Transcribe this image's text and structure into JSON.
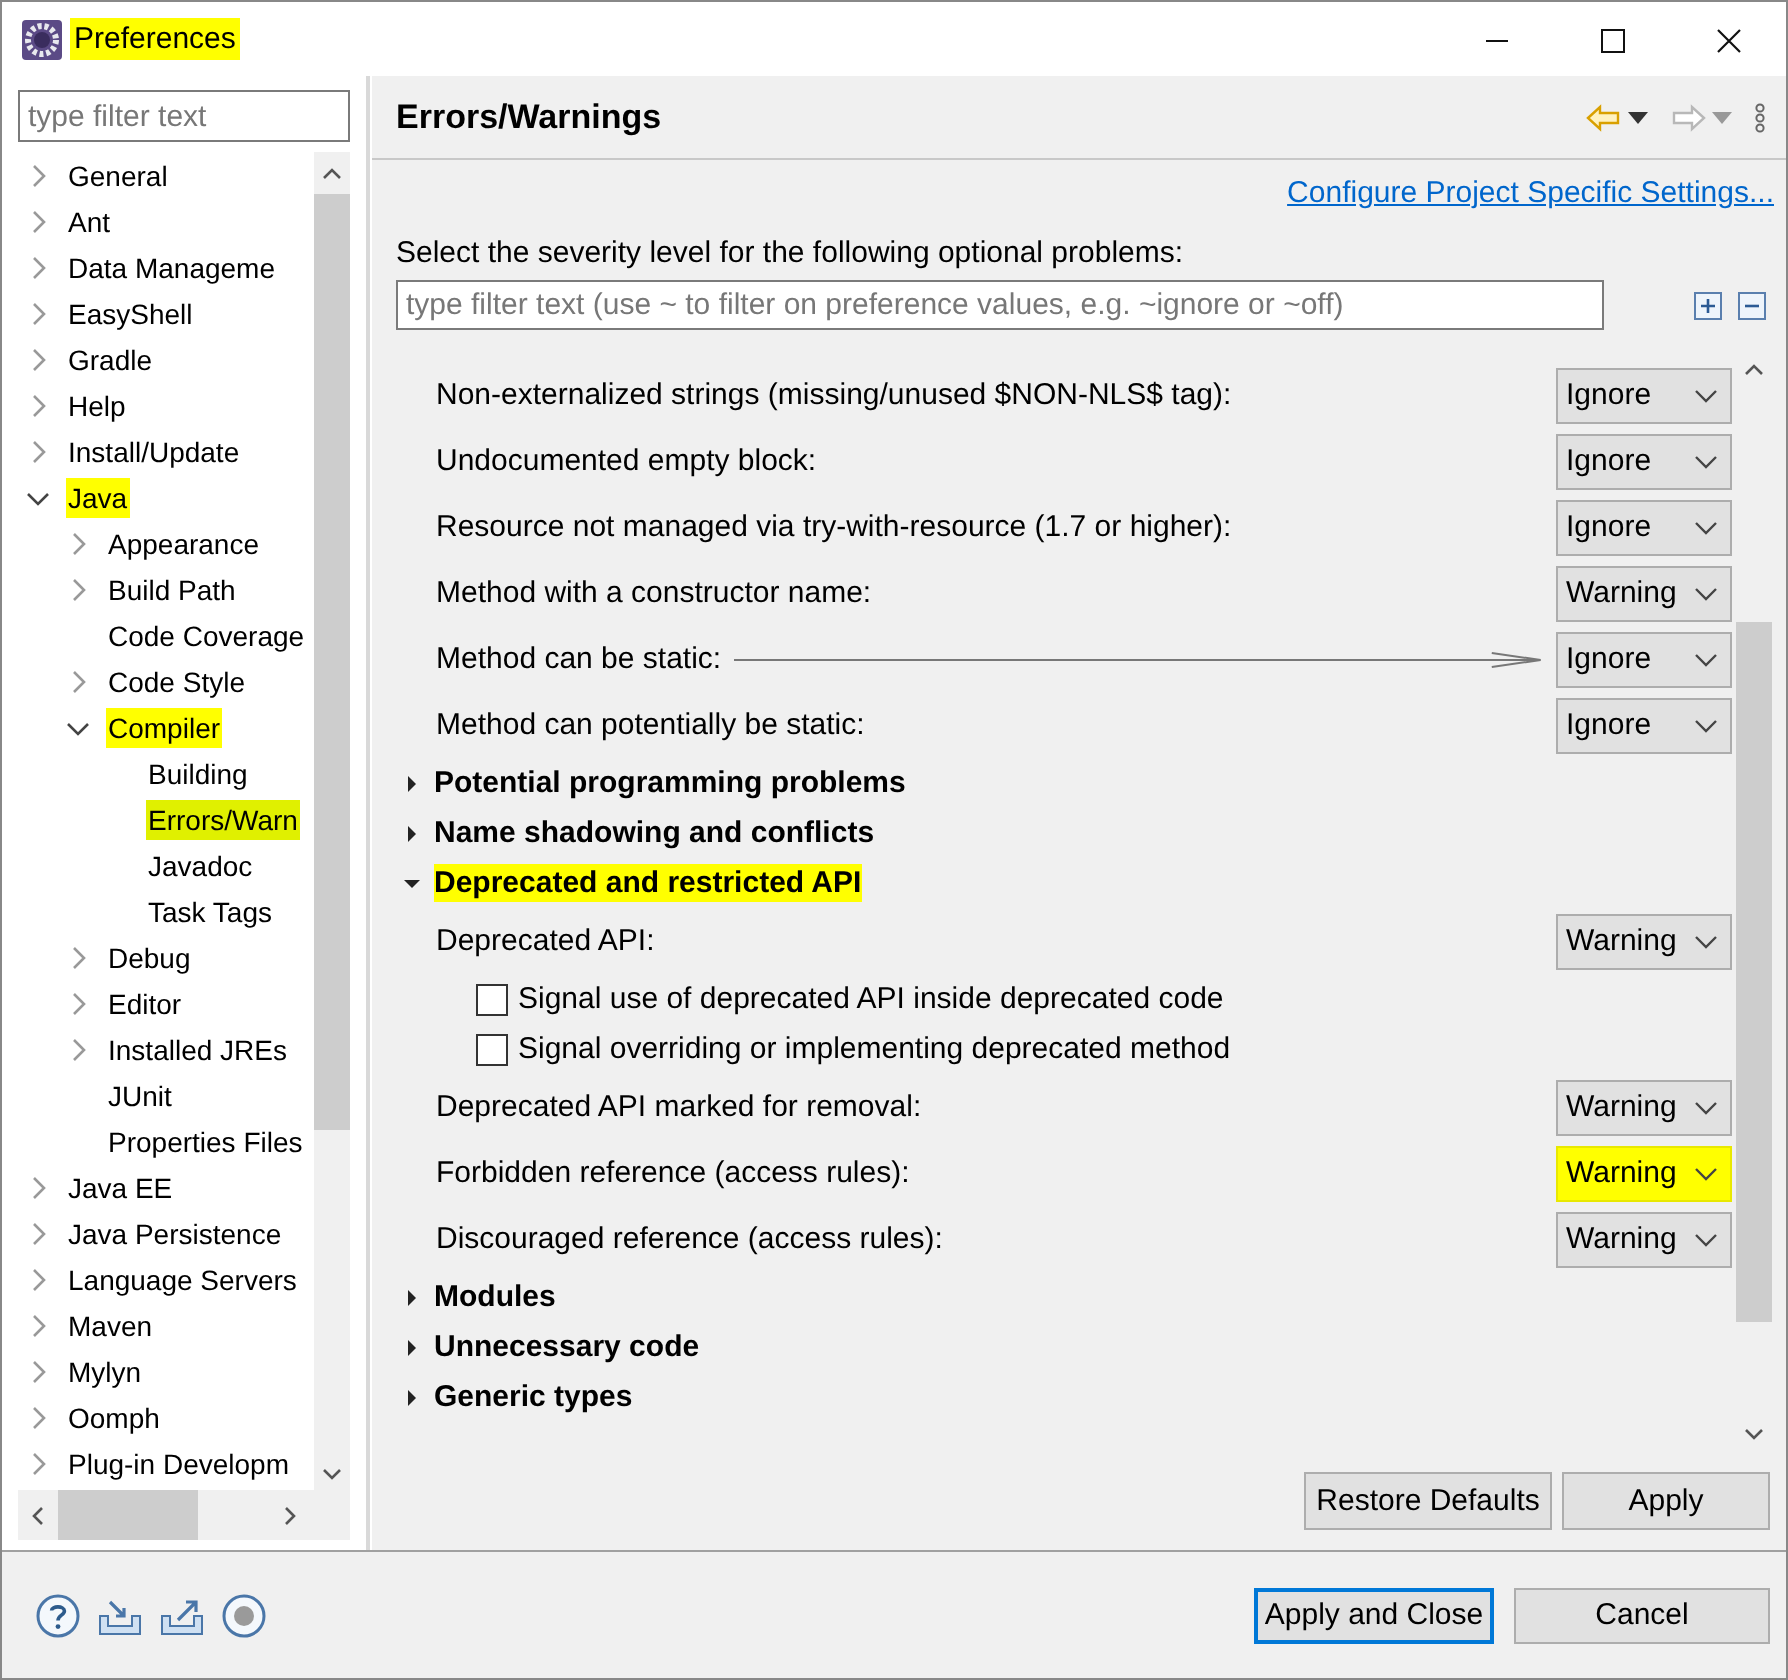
{
  "window": {
    "title": "Preferences",
    "title_highlighted": true
  },
  "sidebar": {
    "filter": {
      "placeholder": "type filter text"
    },
    "tree": [
      {
        "label": "General",
        "expanded": false,
        "selected": false,
        "highlighted": false
      },
      {
        "label": "Ant",
        "expanded": false,
        "selected": false,
        "highlighted": false
      },
      {
        "label": "Data Manageme",
        "expanded": false,
        "selected": false,
        "highlighted": false
      },
      {
        "label": "EasyShell",
        "expanded": false,
        "selected": false,
        "highlighted": false
      },
      {
        "label": "Gradle",
        "expanded": false,
        "selected": false,
        "highlighted": false
      },
      {
        "label": "Help",
        "expanded": false,
        "selected": false,
        "highlighted": false
      },
      {
        "label": "Install/Update",
        "expanded": false,
        "selected": false,
        "highlighted": false
      },
      {
        "label": "Java",
        "expanded": true,
        "selected": false,
        "highlighted": true,
        "children": [
          {
            "label": "Appearance",
            "expanded": false,
            "selected": false,
            "highlighted": false
          },
          {
            "label": "Build Path",
            "expanded": false,
            "selected": false,
            "highlighted": false
          },
          {
            "label": "Code Coverage",
            "selected": false,
            "highlighted": false
          },
          {
            "label": "Code Style",
            "expanded": false,
            "selected": false,
            "highlighted": false
          },
          {
            "label": "Compiler",
            "expanded": true,
            "selected": false,
            "highlighted": true,
            "children": [
              {
                "label": "Building",
                "selected": false,
                "highlighted": false
              },
              {
                "label": "Errors/Warn",
                "selected": true,
                "highlighted": true
              },
              {
                "label": "Javadoc",
                "selected": false,
                "highlighted": false
              },
              {
                "label": "Task Tags",
                "selected": false,
                "highlighted": false
              }
            ]
          },
          {
            "label": "Debug",
            "expanded": false,
            "selected": false,
            "highlighted": false
          },
          {
            "label": "Editor",
            "expanded": false,
            "selected": false,
            "highlighted": false
          },
          {
            "label": "Installed JREs",
            "expanded": false,
            "selected": false,
            "highlighted": false
          },
          {
            "label": "JUnit",
            "selected": false,
            "highlighted": false
          },
          {
            "label": "Properties Files",
            "selected": false,
            "highlighted": false
          }
        ]
      },
      {
        "label": "Java EE",
        "expanded": false,
        "selected": false,
        "highlighted": false
      },
      {
        "label": "Java Persistence",
        "expanded": false,
        "selected": false,
        "highlighted": false
      },
      {
        "label": "Language Servers",
        "expanded": false,
        "selected": false,
        "highlighted": false
      },
      {
        "label": "Maven",
        "expanded": false,
        "selected": false,
        "highlighted": false
      },
      {
        "label": "Mylyn",
        "expanded": false,
        "selected": false,
        "highlighted": false
      },
      {
        "label": "Oomph",
        "expanded": false,
        "selected": false,
        "highlighted": false
      },
      {
        "label": "Plug-in Developm",
        "expanded": false,
        "selected": false,
        "highlighted": false
      }
    ]
  },
  "page": {
    "title": "Errors/Warnings",
    "link": "Configure Project Specific Settings...",
    "description": "Select the severity level for the following optional problems:",
    "filter": {
      "placeholder": "type filter text (use ~ to filter on preference values, e.g. ~ignore or ~off)"
    },
    "items": [
      {
        "kind": "setting",
        "label": "Non-externalized strings (missing/unused $NON-NLS$ tag):",
        "value": "Ignore",
        "highlighted": false,
        "arrow": false
      },
      {
        "kind": "setting",
        "label": "Undocumented empty block:",
        "value": "Ignore",
        "highlighted": false,
        "arrow": false
      },
      {
        "kind": "setting",
        "label": "Resource not managed via try-with-resource (1.7 or higher):",
        "value": "Ignore",
        "highlighted": false,
        "arrow": false
      },
      {
        "kind": "setting",
        "label": "Method with a constructor name:",
        "value": "Warning",
        "highlighted": false,
        "arrow": false
      },
      {
        "kind": "setting",
        "label": "Method can be static:",
        "value": "Ignore",
        "highlighted": false,
        "arrow": true
      },
      {
        "kind": "setting",
        "label": "Method can potentially be static:",
        "value": "Ignore",
        "highlighted": false,
        "arrow": false
      },
      {
        "kind": "section",
        "label": "Potential programming problems",
        "expanded": false,
        "highlighted": false
      },
      {
        "kind": "section",
        "label": "Name shadowing and conflicts",
        "expanded": false,
        "highlighted": false
      },
      {
        "kind": "section",
        "label": "Deprecated and restricted API",
        "expanded": true,
        "highlighted": true
      },
      {
        "kind": "setting",
        "label": "Deprecated API:",
        "value": "Warning",
        "highlighted": false,
        "arrow": false
      },
      {
        "kind": "checkbox",
        "label": "Signal use of deprecated API inside deprecated code",
        "checked": false
      },
      {
        "kind": "checkbox",
        "label": "Signal overriding or implementing deprecated method",
        "checked": false
      },
      {
        "kind": "setting",
        "label": "Deprecated API marked for removal:",
        "value": "Warning",
        "highlighted": false,
        "arrow": false
      },
      {
        "kind": "setting",
        "label": "Forbidden reference (access rules):",
        "value": "Warning",
        "highlighted": true,
        "arrow": false
      },
      {
        "kind": "setting",
        "label": "Discouraged reference (access rules):",
        "value": "Warning",
        "highlighted": false,
        "arrow": false
      },
      {
        "kind": "section",
        "label": "Modules",
        "expanded": false,
        "highlighted": false
      },
      {
        "kind": "section",
        "label": "Unnecessary code",
        "expanded": false,
        "highlighted": false
      },
      {
        "kind": "section",
        "label": "Generic types",
        "expanded": false,
        "highlighted": false
      }
    ],
    "buttons": [
      "Restore Defaults",
      "Apply"
    ]
  },
  "footer": {
    "buttons": [
      {
        "label": "Apply and Close",
        "default": true
      },
      {
        "label": "Cancel",
        "default": false
      }
    ]
  }
}
